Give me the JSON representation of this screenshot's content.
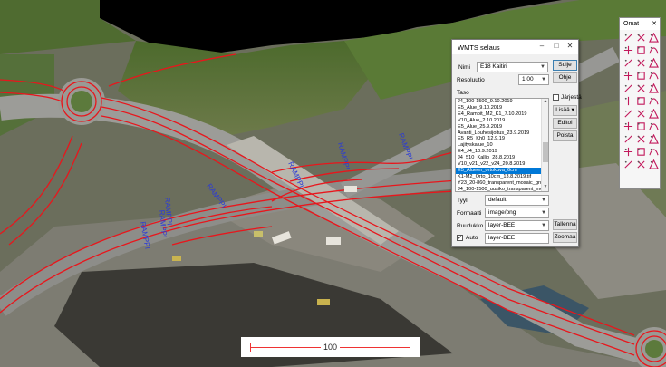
{
  "map": {
    "labels": [
      "RAMPPI",
      "RAMPPI",
      "RAMPPI",
      "RAMPPI",
      "RAMPPI",
      "RAMPPI",
      "RAMPPI"
    ],
    "scale_label": "100"
  },
  "dialog": {
    "title": "WMTS selaus",
    "nimi_label": "Nimi",
    "nimi_value": "E18 Kaitiri",
    "resoluutio_label": "Resoluutio",
    "resoluutio_value": "1.00",
    "taso_label": "Taso",
    "layers": [
      "J4_100-1500_9.10.2019",
      "E5_Alue_9.10.2019",
      "E4_Rampit_M2_K1_7.10.2019",
      "V10_Alue_2.10.2019",
      "E5_Alue_25.9.2019",
      "Avanti_Louhesijoitus_23.9.2019",
      "E5_R5_Kh0_12.9.19",
      "Lajityskalue_10",
      "E4_J4_10.9.2019",
      "J4_510_Kallio_28.8.2019",
      "V10_v21_v22_v24_20.8.2019",
      "E5_Alueen_ortokuva_6cm",
      "K1-M2_Orto_10cm_13.8.2019.tif",
      "Y23_20-860_transparent_mosaic_gro",
      "J4_100-1500_uusiko_transparent_moi"
    ],
    "selected_index": 11,
    "jarjesta_label": "Järjestä",
    "tyyli_label": "Tyyli",
    "tyyli_value": "default",
    "formaatti_label": "Formaatti",
    "formaatti_value": "image/png",
    "ruudukko_label": "Ruudukko",
    "ruudukko_value": "layer-BEE",
    "auto_label": "Auto",
    "auto_value": "layer-BEE",
    "buttons": {
      "sulje": "Sulje",
      "ohje": "Ohje",
      "lisaa": "Lisää",
      "editoi": "Editoi",
      "poista": "Poista",
      "tallenna": "Tallenna",
      "zoomaa": "Zoomaa"
    }
  },
  "omat": {
    "title": "Omat",
    "tools": [
      "t1-icon",
      "t2-icon",
      "t3-icon",
      "t4-icon",
      "t5-icon",
      "t6-icon",
      "t7-icon",
      "t8-icon",
      "t9-icon",
      "t10-icon",
      "t11-icon",
      "t12-icon",
      "t13-icon",
      "t14-icon",
      "t15-icon",
      "t16-icon",
      "t17-icon",
      "t18-icon",
      "t19-icon",
      "t20-icon",
      "t21-icon",
      "t22-icon",
      "t23-icon",
      "t24-icon",
      "t25-icon",
      "t26-icon",
      "t27-icon",
      "t28-icon",
      "t29-icon",
      "t30-icon",
      "t31-icon",
      "t32-icon",
      "t33-icon"
    ]
  },
  "colors": {
    "alignment": "#e8161c",
    "label": "#2a3ad8",
    "selection": "#0078d7"
  }
}
